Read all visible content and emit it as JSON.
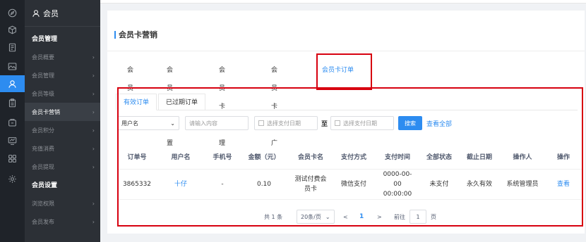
{
  "rail": {
    "icons": [
      "compass-icon",
      "cube-icon",
      "document-icon",
      "image-icon",
      "user-icon",
      "clipboard-icon",
      "wallet-icon",
      "monitor-icon",
      "grid-icon",
      "gear-icon"
    ]
  },
  "menu": {
    "header": "会员",
    "groups": [
      {
        "title": "会员管理",
        "items": [
          {
            "label": "会员概要"
          },
          {
            "label": "会员管理"
          },
          {
            "label": "会员等级"
          },
          {
            "label": "会员卡营销"
          },
          {
            "label": "会员积分"
          },
          {
            "label": "充值消费"
          },
          {
            "label": "会员提现"
          }
        ]
      },
      {
        "title": "会员设置",
        "items": [
          {
            "label": "浏览权限"
          },
          {
            "label": "会员发布"
          }
        ]
      }
    ]
  },
  "page": {
    "title": "会员卡营销",
    "tabs": [
      "会员卡",
      "会员卡设置",
      "会员卡管理",
      "会员卡推广",
      "会员卡订单"
    ],
    "active_tab": "会员卡订单",
    "sub_tabs": [
      "有效订单",
      "已过期订单"
    ],
    "active_sub_tab": "有效订单"
  },
  "filters": {
    "field_select": "用户名",
    "keyword_placeholder": "请输入内容",
    "date_start_placeholder": "选择支付日期",
    "to_label": "至",
    "date_end_placeholder": "选择支付日期",
    "search_button": "搜索",
    "view_all": "查看全部"
  },
  "table": {
    "columns": [
      "订单号",
      "用户名",
      "手机号",
      "金额（元）",
      "会员卡名",
      "支付方式",
      "支付时间",
      "全部状态",
      "截止日期",
      "操作人",
      "操作"
    ],
    "rows": [
      {
        "order_no": "3865332",
        "username": "十仔",
        "phone": "-",
        "amount": "0.10",
        "card_name": "测试付费会员卡",
        "pay_method": "微信支付",
        "pay_time": "0000-00-00 00:00:00",
        "status": "未支付",
        "deadline": "永久有效",
        "operator": "系统管理员",
        "action": "查看"
      }
    ]
  },
  "pagination": {
    "total": "共 1 条",
    "page_size": "20条/页",
    "prev": "<",
    "current": "1",
    "next": ">",
    "goto_label": "前往",
    "goto_value": "1",
    "page_suffix": "页"
  },
  "colors": {
    "accent": "#2d8cf0",
    "highlight_box": "#d7000f",
    "rail_bg": "#1f2329",
    "menu_bg": "#2c3036"
  }
}
